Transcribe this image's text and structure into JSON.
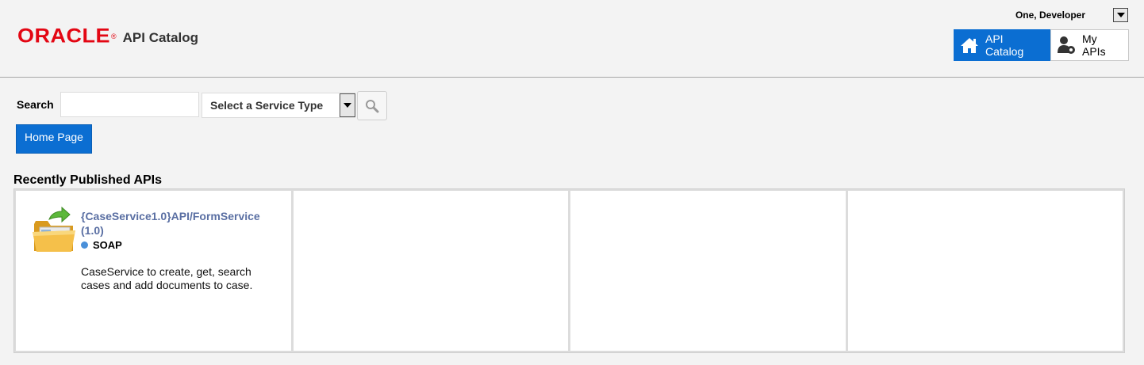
{
  "header": {
    "logo_text": "ORACLE",
    "app_title": "API Catalog",
    "user_name": "One, Developer",
    "nav": [
      {
        "label": "API Catalog",
        "icon": "home-icon",
        "active": true
      },
      {
        "label": "My APIs",
        "icon": "user-gear-icon",
        "active": false
      }
    ]
  },
  "search": {
    "label": "Search",
    "input_value": "",
    "input_placeholder": "",
    "service_type_selected": "Select a Service Type",
    "search_button_icon": "magnifier-icon"
  },
  "home_button_label": "Home Page",
  "recent": {
    "title": "Recently Published APIs",
    "items": [
      {
        "title": "{CaseService1.0}API/FormService (1.0)",
        "type": "SOAP",
        "description": "CaseService to create, get, search cases and add documents to case."
      }
    ]
  },
  "colors": {
    "accent": "#0b6ed2",
    "brand_red": "#e30613",
    "link": "#5a6fa3",
    "soap_dot": "#4a90d9"
  }
}
